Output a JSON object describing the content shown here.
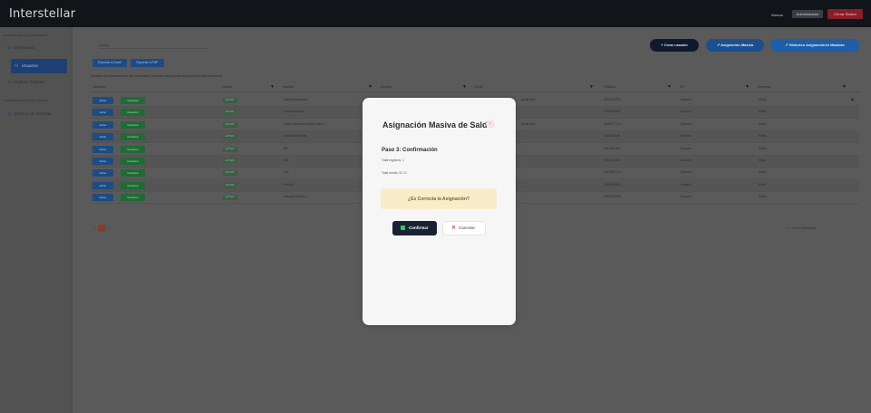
{
  "app": {
    "title": "Interstellar"
  },
  "topbar": {
    "user": "Arecua",
    "role": "Administrador",
    "logout": "Cerrar Sesion"
  },
  "sidebar": {
    "section1": "GESTION DE LA PLATAFORMA",
    "section2": "ADMINISTRACION DE SISTEMA",
    "items": [
      {
        "label": "Dashboard",
        "icon": "grid-icon"
      },
      {
        "label": "Usuarios",
        "icon": "users-icon"
      },
      {
        "label": "Reporte Tableau",
        "icon": "chart-icon"
      },
      {
        "label": "Balance de Cuentas",
        "icon": "grid-icon"
      }
    ]
  },
  "main": {
    "breadcrumb": "usuario",
    "buttons": {
      "create": "+ Crear usuario",
      "mass": "↗ Asignación Masiva",
      "history": "↗ Historico Asignaciones Masivas"
    },
    "export": {
      "excel": "Exportar a Excel",
      "pdf": "Exportar a PDF"
    },
    "hint": "Arrastre el encabezado de columna y suéltelo aquí para agrupar por esa columna",
    "columns": [
      "Acciones",
      "Estado",
      "Nombre",
      "Apellido",
      "Email",
      "Teléfono",
      "Rol",
      "Empresa"
    ],
    "row_buttons": {
      "edit": "Editar",
      "view": "Visualizar"
    },
    "rows": [
      {
        "status": "ACTIVO",
        "name": "Diana Betancourt",
        "email": "gmail.com",
        "phone": "3001478731",
        "role": "Usuario",
        "company": "Mirza"
      },
      {
        "status": "ACTIVO",
        "name": "Administracion",
        "email": "",
        "phone": "3004567834",
        "role": "Usuario",
        "company": "Mirza"
      },
      {
        "status": "ACTIVO",
        "name": "Linda Estefanía García Sierra",
        "email": "gmail.com",
        "phone": "3009977172",
        "role": "Usuario",
        "company": "Mirza"
      },
      {
        "status": "ACTIVO",
        "name": "Elena Escobedo",
        "email": "",
        "phone": "3004411146",
        "role": "Usuario",
        "company": "Mirza"
      },
      {
        "status": "ACTIVO",
        "name": "BB",
        "email": "",
        "phone": "3013342167",
        "role": "Usuario",
        "company": "Mirza"
      },
      {
        "status": "ACTIVO",
        "name": "bris",
        "email": "",
        "phone": "3013342171",
        "role": "Usuario",
        "company": "Mirza"
      },
      {
        "status": "ACTIVO",
        "name": "bris",
        "email": "",
        "phone": "3013342172",
        "role": "Usuario",
        "company": "Mirza"
      },
      {
        "status": "ACTIVO",
        "name": "Usuario",
        "email": "",
        "phone": "3009933324",
        "role": "Usuario",
        "company": "Mirza"
      },
      {
        "status": "ACTIVO",
        "name": "Usuario Prueba 2",
        "email": "",
        "phone": "3009933325",
        "role": "Usuario",
        "company": "Mirza"
      }
    ],
    "pager": {
      "prev": "‹ ‹",
      "current": "1",
      "next": "› ›"
    },
    "range": "1 - 9 de 9 elementos"
  },
  "modal": {
    "title": "Asignación Masiva de Saldo",
    "close": "×",
    "step": "Paso 3: Confirmación",
    "line1": "Total registros: 1",
    "line2_label": "Total monto:",
    "line2_value": "$3.00",
    "confirm_question": "¿Es Correcta la Asignación?",
    "ok": "Confirmar",
    "cancel": "Cancelar"
  }
}
